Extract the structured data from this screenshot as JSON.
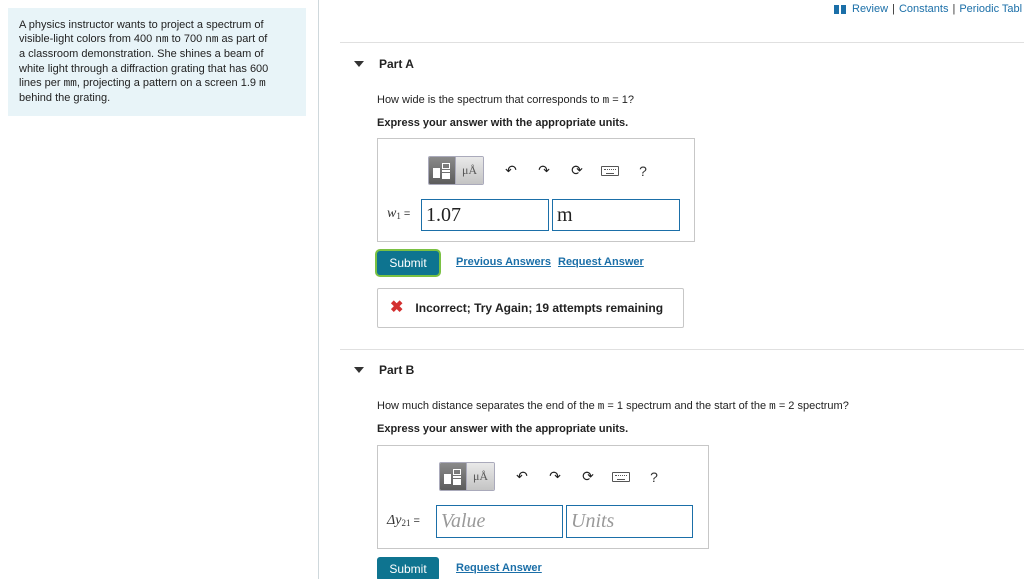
{
  "problem": {
    "lines": [
      [
        "A physics instructor wants to project a spectrum of"
      ],
      [
        "visible-light colors from 400 ",
        {
          "m": "nm"
        },
        " to 700 ",
        {
          "m": "nm"
        },
        " as part of"
      ],
      [
        "a classroom demonstration. She shines a beam of"
      ],
      [
        "white light through a diffraction grating that has 600"
      ],
      [
        "lines per ",
        {
          "m": "mm"
        },
        ", projecting a pattern on a screen 1.9 ",
        {
          "m": "m"
        }
      ],
      [
        "behind the grating."
      ]
    ]
  },
  "toplinks": {
    "review": "Review",
    "constants": "Constants",
    "periodic": "Periodic Tabl",
    "sep": "|"
  },
  "partA": {
    "title": "Part A",
    "question_pre": "How wide is the spectrum that corresponds to ",
    "question_var": "m",
    "question_post": " = 1?",
    "instruction": "Express your answer with the appropriate units.",
    "var_symbol": "w",
    "var_sub": "1",
    "eq": "=",
    "value": "1.07",
    "units": "m",
    "submit": "Submit",
    "prev_answers": "Previous Answers",
    "request_answer": "Request Answer",
    "feedback": "Incorrect; Try Again; 19 attempts remaining",
    "feedback_icon": "✖"
  },
  "partB": {
    "title": "Part B",
    "question_pre": "How much distance separates the end of the ",
    "question_var1": "m",
    "question_mid": " = 1 spectrum and the start of the ",
    "question_var2": "m",
    "question_post": " = 2 spectrum?",
    "instruction": "Express your answer with the appropriate units.",
    "var_symbol": "Δy",
    "var_sub": "21",
    "eq": "=",
    "value_placeholder": "Value",
    "units_placeholder": "Units",
    "submit": "Submit",
    "request_answer": "Request Answer"
  },
  "toolbar": {
    "mu": "μÅ",
    "undo": "↶",
    "redo": "↷",
    "reset": "⟳",
    "help": "?"
  },
  "icons": [
    "book-icon",
    "caret-down-icon",
    "template-icon",
    "units-icon",
    "undo-icon",
    "redo-icon",
    "reset-icon",
    "keyboard-icon",
    "help-icon",
    "x-icon"
  ],
  "colors": {
    "accent": "#1b6fa8",
    "submit": "#0e7490",
    "error": "#d32f2f",
    "panel": "#e8f4f8"
  }
}
